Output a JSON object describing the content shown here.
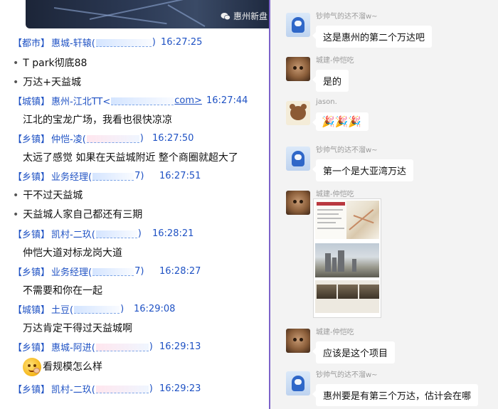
{
  "left_chat": {
    "watermark": "惠州新盘",
    "messages": [
      {
        "tag": "【都市】",
        "name": "惠城-轩辕(",
        "time": "16:27:25",
        "lines": []
      },
      {
        "tag": null,
        "name": null,
        "time": null,
        "lines": [
          "T park彻底88"
        ]
      },
      {
        "tag": null,
        "name": null,
        "time": null,
        "lines": [
          "万达+天益城"
        ]
      },
      {
        "tag": "【城镇】",
        "name": "惠州-江北TT<",
        "email": "com>",
        "time": "16:27:44",
        "lines": [
          "江北的宝龙广场，我看也很快凉凉"
        ]
      },
      {
        "tag": "【乡镇】",
        "name": "仲恺-凌(",
        "time": "16:27:50",
        "lines": [
          "太远了感觉 如果在天益城附近 整个商圈就超大了"
        ]
      },
      {
        "tag": "【乡镇】",
        "name": "业务经理(",
        "suffix": "7)",
        "time": "16:27:51",
        "lines": [
          "干不过天益城",
          "天益城人家自己都还有三期"
        ]
      },
      {
        "tag": "【乡镇】",
        "name": "凯村-二玖(",
        "time": "16:28:21",
        "lines": [
          "仲恺大道对标龙岗大道"
        ]
      },
      {
        "tag": "【乡镇】",
        "name": "业务经理(",
        "suffix": "7)",
        "time": "16:28:27",
        "lines": [
          "不需要和你在一起"
        ]
      },
      {
        "tag": "【城镇】",
        "name": "土豆(",
        "suffix": ")",
        "time": "16:29:08",
        "lines": [
          "万达肯定干得过天益城啊"
        ]
      },
      {
        "tag": "【乡镇】",
        "name": "惠城-阿进(",
        "time": "16:29:13",
        "lines": [
          "看规模怎么样"
        ]
      },
      {
        "tag": "【乡镇】",
        "name": "凯村-二玖(",
        "time": "16:29:23",
        "lines": []
      }
    ]
  },
  "right_chat": {
    "messages": [
      {
        "sender": "钞帅气的达不溜w~",
        "text": "这是惠州的第二个万达吧"
      },
      {
        "sender": "城建-仲恺吃",
        "text": "是的"
      },
      {
        "sender": "jason.",
        "text": "🎉🎉🎉"
      },
      {
        "sender": "钞帅气的达不溜w~",
        "text": "第一个是大亚湾万达"
      },
      {
        "sender": "城建-仲恺吃",
        "text": ""
      },
      {
        "sender": "城建-仲恺吃",
        "text": "应该是这个项目"
      },
      {
        "sender": "钞帅气的达不溜w~",
        "text": "惠州要是有第三个万达，估计会在哪"
      }
    ]
  },
  "colors": {
    "qq_blue": "#1f52c4",
    "divider": "#7c63c9",
    "wechat_bg": "#f3f3f3"
  }
}
